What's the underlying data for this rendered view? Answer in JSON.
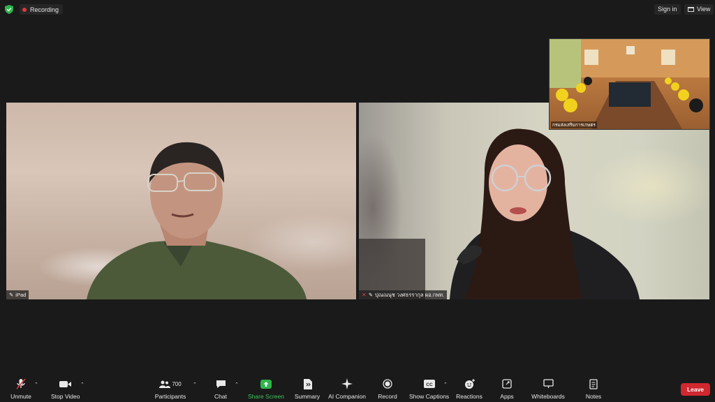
{
  "topbar": {
    "recording_label": "Recording",
    "signin_label": "Sign in",
    "view_label": "View"
  },
  "videos": {
    "left_name": "iPad",
    "right_name": "ปุณณนุช วงศธรรากุล ผอ.กพท.",
    "thumb_name": "กรมส่งเสริมการเกษตร"
  },
  "toolbar": {
    "unmute": "Unmute",
    "stop_video": "Stop Video",
    "participants": "Participants",
    "participants_count": "700",
    "chat": "Chat",
    "share_screen": "Share Screen",
    "summary": "Summary",
    "ai_companion": "AI Companion",
    "record": "Record",
    "show_captions": "Show Captions",
    "reactions": "Reactions",
    "apps": "Apps",
    "whiteboards": "Whiteboards",
    "notes": "Notes",
    "leave": "Leave"
  },
  "colors": {
    "background": "#1a1a1a",
    "recording_dot": "#e0383e",
    "share_green": "#3fc45a",
    "leave_red": "#d1282f",
    "shield_green": "#2fb44c"
  }
}
